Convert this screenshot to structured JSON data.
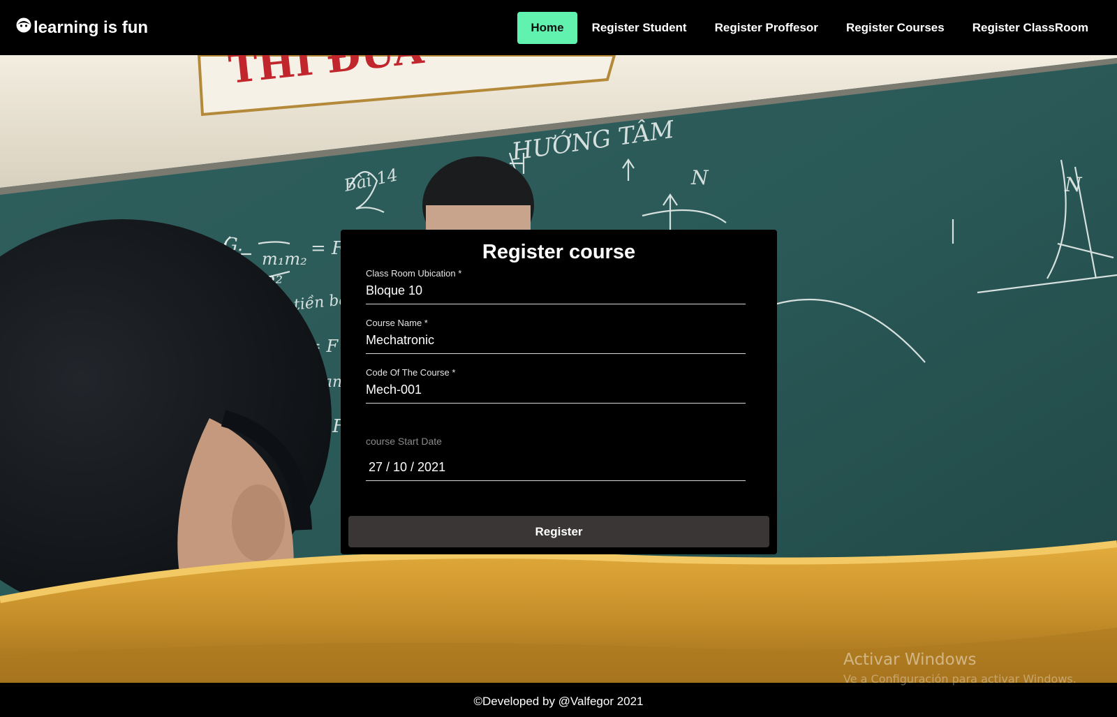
{
  "brand": {
    "name": "learning is fun",
    "icon": "face-icon"
  },
  "nav": {
    "items": [
      {
        "label": "Home",
        "active": true
      },
      {
        "label": "Register Student",
        "active": false
      },
      {
        "label": "Register Proffesor",
        "active": false
      },
      {
        "label": "Register Courses",
        "active": false
      },
      {
        "label": "Register ClassRoom",
        "active": false
      }
    ],
    "active_color": "#62f2b0"
  },
  "form": {
    "title": "Register course",
    "fields": [
      {
        "label": "Class Room Ubication *",
        "value": "Bloque 10"
      },
      {
        "label": "Course Name *",
        "value": "Mechatronic"
      },
      {
        "label": "Code Of The Course *",
        "value": "Mech-001"
      }
    ],
    "date": {
      "label": "course Start Date",
      "value": "27 / 10 / 2021"
    },
    "submit_label": "Register"
  },
  "watermark": {
    "title": "Activar Windows",
    "subtitle": "Ve a Configuración para activar Windows."
  },
  "footer": {
    "text": "©Developed by @Valfegor 2021"
  }
}
